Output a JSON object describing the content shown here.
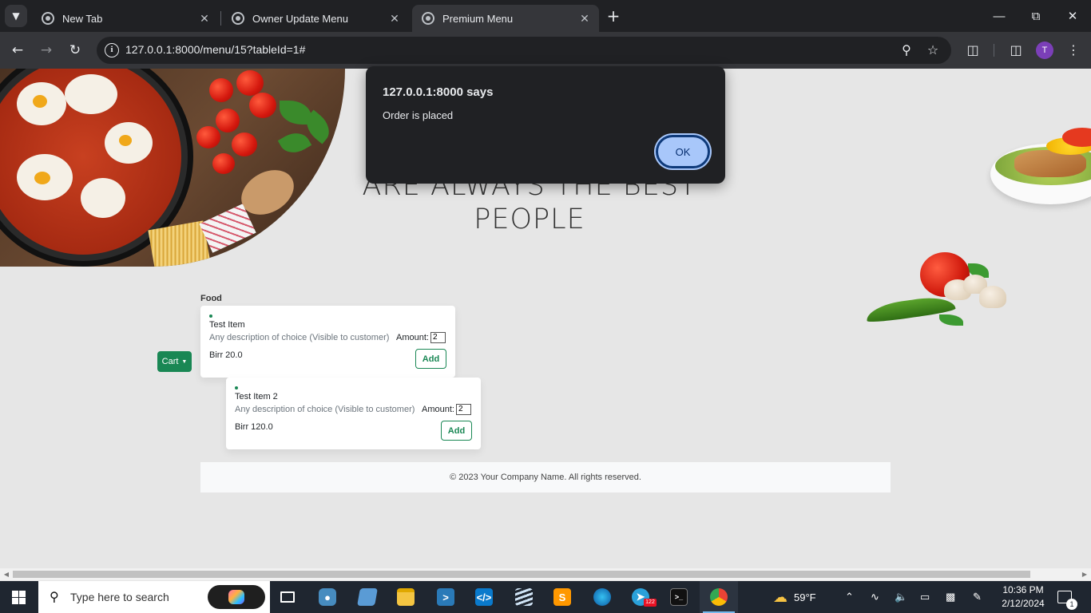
{
  "browser": {
    "tabs": [
      {
        "title": "New Tab"
      },
      {
        "title": "Owner Update Menu"
      },
      {
        "title": "Premium Menu"
      }
    ],
    "url": "127.0.0.1:8000/menu/15?tableId=1#",
    "profile_initial": "T"
  },
  "page": {
    "hero_text_line1": "ARE ALWAYS THE BEST",
    "hero_text_line2": "PEOPLE",
    "category": "Food",
    "cart_label": "Cart",
    "items": [
      {
        "name": "Test Item",
        "description": "Any description of choice (Visible to customer)",
        "amount_label": "Amount:",
        "amount": "2",
        "price": "Birr 20.0",
        "add_label": "Add"
      },
      {
        "name": "Test Item 2",
        "description": "Any description of choice (Visible to customer)",
        "amount_label": "Amount:",
        "amount": "2",
        "price": "Birr 120.0",
        "add_label": "Add"
      }
    ],
    "footer": "© 2023 Your Company Name. All rights reserved."
  },
  "dialog": {
    "title": "127.0.0.1:8000 says",
    "message": "Order is placed",
    "ok_label": "OK"
  },
  "taskbar": {
    "search_placeholder": "Type here to search",
    "weather": "59°F",
    "time": "10:36 PM",
    "date": "2/12/2024",
    "telegram_badge": "122",
    "notification_count": "1"
  },
  "colors": {
    "accent_green": "#198754",
    "dialog_bg": "#202124",
    "ok_button": "#a8c7fa"
  }
}
